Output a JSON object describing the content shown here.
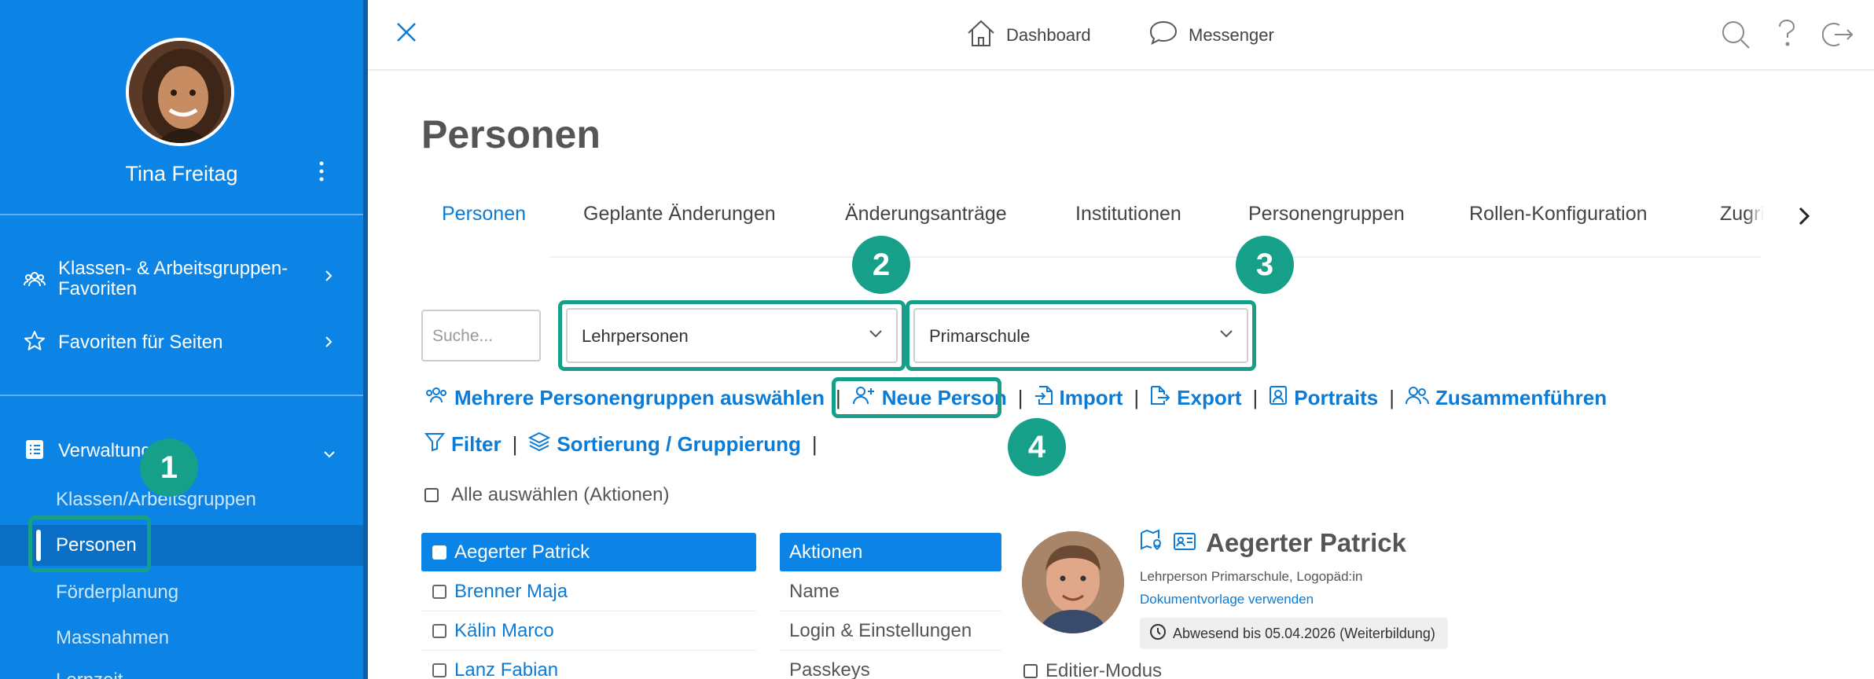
{
  "user": {
    "name": "Tina Freitag",
    "menu_icon": "kebab-menu-icon"
  },
  "sidebar": {
    "sections": [
      {
        "label": "Klassen- & Arbeitsgruppen-Favoriten",
        "line1": "Klassen- & Arbeitsgruppen-",
        "line2": "Favoriten",
        "icon": "group-icon"
      },
      {
        "label": "Favoriten für Seiten",
        "icon": "star-icon"
      },
      {
        "label": "Verwaltung",
        "icon": "list-icon"
      }
    ],
    "sub_items": [
      "Klassen/Arbeitsgruppen",
      "Personen",
      "Förderplanung",
      "Massnahmen",
      "Lernzeit"
    ]
  },
  "topbar": {
    "dashboard": "Dashboard",
    "messenger": "Messenger"
  },
  "page": {
    "title": "Personen"
  },
  "tabs": [
    "Personen",
    "Geplante Änderungen",
    "Änderungsanträge",
    "Institutionen",
    "Personengruppen",
    "Rollen-Konfiguration",
    "Zugri"
  ],
  "filters": {
    "search_placeholder": "Suche...",
    "group_value": "Lehrpersonen",
    "school_value": "Primarschule"
  },
  "actions": {
    "multi_groups": "Mehrere Personengruppen auswählen",
    "new_person": "Neue Person",
    "import": "Import",
    "export": "Export",
    "portraits": "Portraits",
    "merge": "Zusammenführen",
    "filter": "Filter",
    "sort": "Sortierung / Gruppierung",
    "separator": "|"
  },
  "select_all": "Alle auswählen (Aktionen)",
  "persons": [
    "Aegerter Patrick",
    "Brenner Maja",
    "Kälin Marco",
    "Lanz Fabian"
  ],
  "person_menu": [
    "Aktionen",
    "Name",
    "Login & Einstellungen",
    "Passkeys"
  ],
  "detail": {
    "name": "Aegerter Patrick",
    "role": "Lehrperson Primarschule, Logopäd:in",
    "link": "Dokumentvorlage verwenden",
    "absence": "Abwesend bis 05.04.2026 (Weiterbildung)",
    "edit_mode": "Editier-Modus"
  },
  "badges": [
    "1",
    "2",
    "3",
    "4"
  ],
  "colors": {
    "sidebar": "#0b84e6",
    "accent": "#0b7bd6",
    "highlight": "#16a08a"
  }
}
